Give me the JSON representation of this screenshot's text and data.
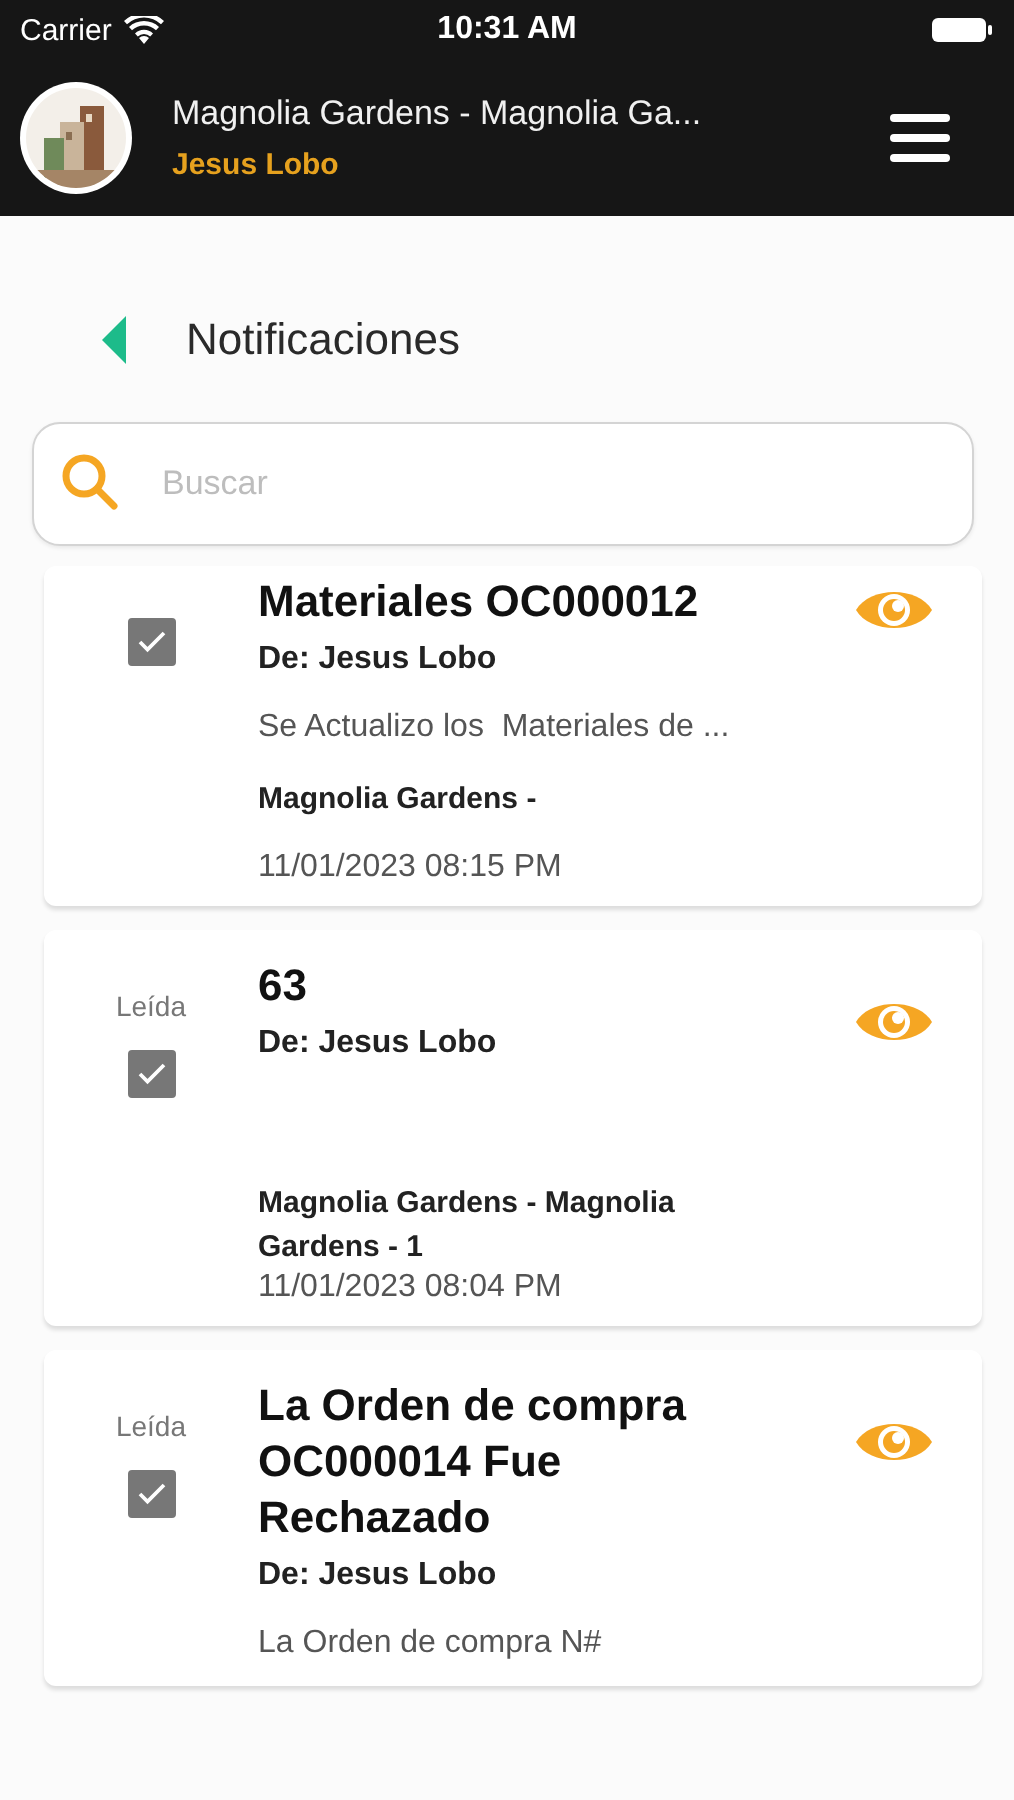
{
  "status_bar": {
    "carrier": "Carrier",
    "time": "10:31 AM"
  },
  "header": {
    "title": "Magnolia Gardens - Magnolia Ga...",
    "user": "Jesus Lobo"
  },
  "page": {
    "title": "Notificaciones"
  },
  "search": {
    "placeholder": "Buscar"
  },
  "notifications": [
    {
      "title": "Materiales OC000012",
      "from": "De: Jesus Lobo",
      "body": "Se Actualizo los  Materiales de ...",
      "project": "Magnolia Gardens -",
      "date": "11/01/2023 08:15 PM",
      "checked": true
    },
    {
      "read_label": "Leída",
      "title": "63",
      "from": "De: Jesus Lobo",
      "project": "Magnolia Gardens - Magnolia Gardens - 1",
      "date": "11/01/2023 08:04 PM",
      "checked": true
    },
    {
      "read_label": "Leída",
      "title": "La Orden de compra OC000014 Fue Rechazado",
      "from": "De: Jesus Lobo",
      "body": "La Orden de compra N#",
      "checked": true
    }
  ]
}
